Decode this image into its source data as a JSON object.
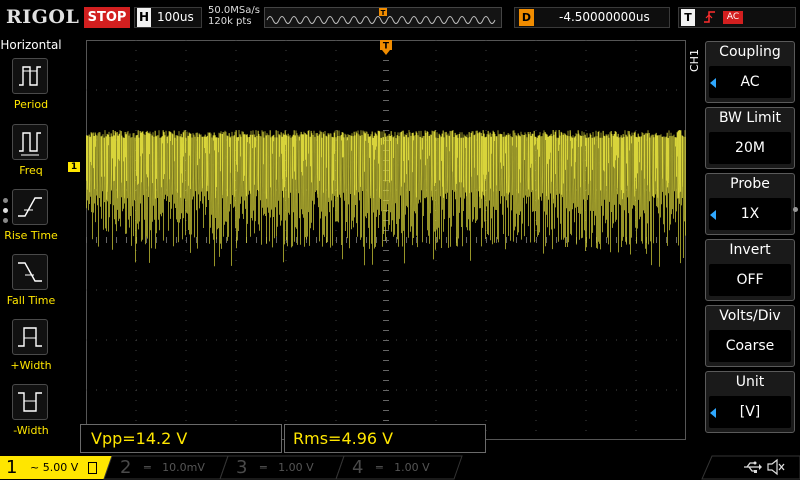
{
  "top": {
    "brand": "RIGOL",
    "run_state": "STOP",
    "horizontal_label": "H",
    "timebase": "100us",
    "sample_rate": "50.0MSa/s",
    "points": "120k pts",
    "delay_label": "D",
    "delay_value": "-4.50000000us",
    "trigger_label": "T",
    "trigger_source": "AC"
  },
  "left_menu": {
    "title": "Horizontal",
    "items": [
      {
        "label": "Period",
        "icon": "period-icon"
      },
      {
        "label": "Freq",
        "icon": "frequency-icon"
      },
      {
        "label": "Rise Time",
        "icon": "rise-time-icon"
      },
      {
        "label": "Fall Time",
        "icon": "fall-time-icon"
      },
      {
        "label": "+Width",
        "icon": "positive-width-icon"
      },
      {
        "label": "-Width",
        "icon": "negative-width-icon"
      }
    ]
  },
  "right_menu": {
    "channel_tag": "CH1",
    "items": [
      {
        "title": "Coupling",
        "value": "AC",
        "arrow": true
      },
      {
        "title": "BW Limit",
        "value": "20M",
        "arrow": false
      },
      {
        "title": "Probe",
        "value": "1X",
        "arrow": true
      },
      {
        "title": "Invert",
        "value": "OFF",
        "arrow": false
      },
      {
        "title": "Volts/Div",
        "value": "Coarse",
        "arrow": false
      },
      {
        "title": "Unit",
        "value": "[V]",
        "arrow": true
      }
    ]
  },
  "measurements": {
    "vpp": "Vpp=14.2 V",
    "rms": "Rms=4.96 V"
  },
  "channels": [
    {
      "num": "1",
      "value": "5.00 V",
      "color": "#ffe600",
      "active": true
    },
    {
      "num": "2",
      "value": "10.0mV",
      "color": "#00c8ff",
      "active": false
    },
    {
      "num": "3",
      "value": "1.00 V",
      "color": "#e040e0",
      "active": false
    },
    {
      "num": "4",
      "value": "1.00 V",
      "color": "#3060ff",
      "active": false
    }
  ],
  "colors": {
    "waveform": "#d8d43a",
    "stop": "#d21f1f",
    "accent_blue": "#2fa8ff",
    "trigger_orange": "#f08c00"
  },
  "status_icons": [
    "usb-icon",
    "speaker-muted-icon"
  ]
}
